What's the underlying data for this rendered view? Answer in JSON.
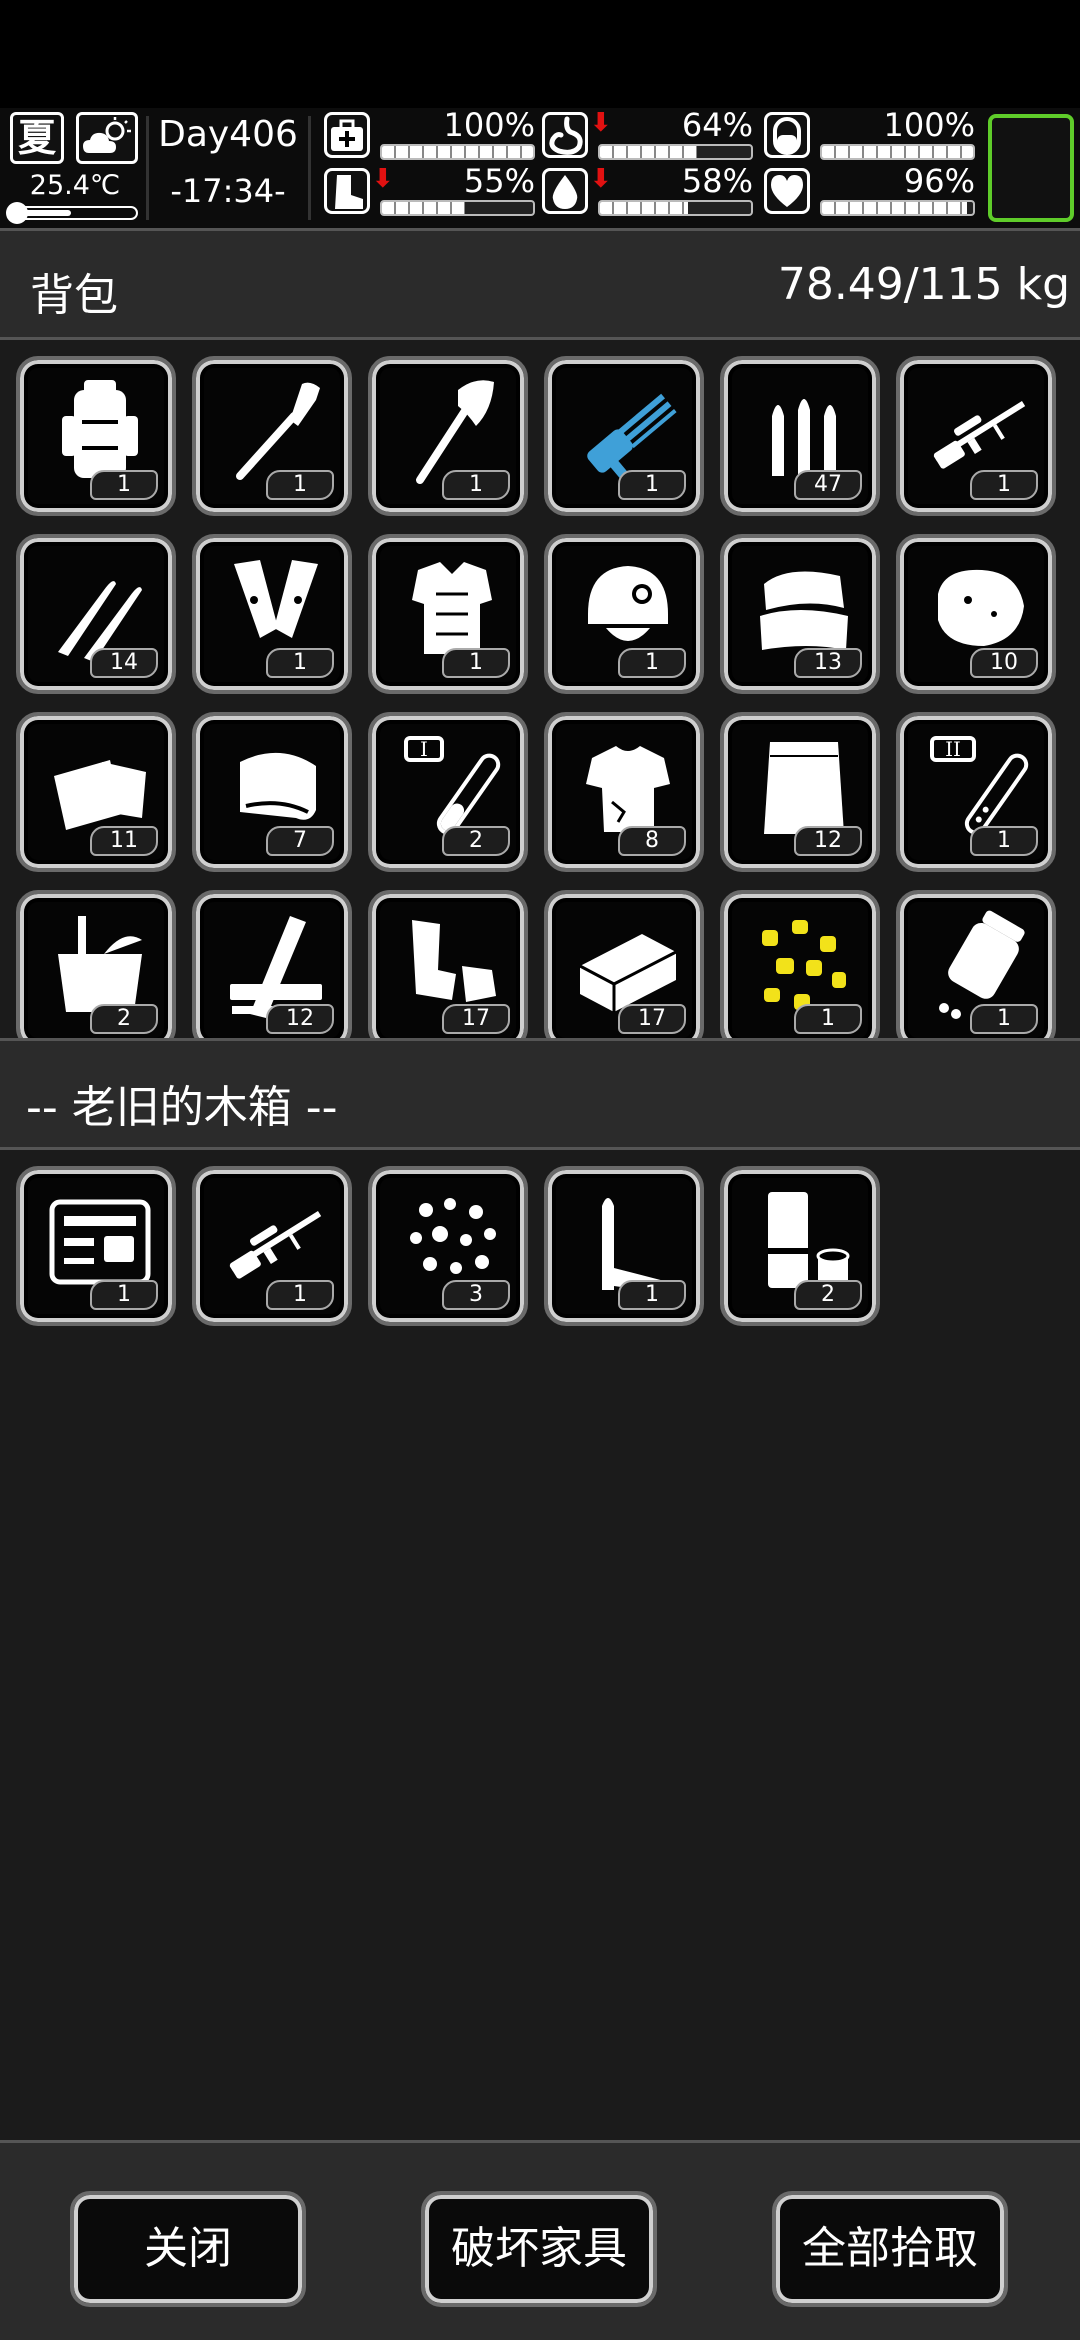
{
  "status": {
    "season": "夏",
    "weather_icon": "partly-cloudy-icon",
    "temperature": "25.4℃",
    "temperature_level": 0.45,
    "day": "Day406",
    "time": "-17:34-",
    "stats": [
      {
        "name": "health",
        "icon": "medkit-icon",
        "percent": "100%",
        "value": 100,
        "decreasing": false
      },
      {
        "name": "hunger",
        "icon": "stomach-icon",
        "percent": "64%",
        "value": 64,
        "decreasing": true
      },
      {
        "name": "sanity",
        "icon": "mind-icon",
        "percent": "100%",
        "value": 100,
        "decreasing": false
      },
      {
        "name": "stamina",
        "icon": "boot-icon",
        "percent": "55%",
        "value": 55,
        "decreasing": true
      },
      {
        "name": "thirst",
        "icon": "water-drop-icon",
        "percent": "58%",
        "value": 58,
        "decreasing": true
      },
      {
        "name": "mood",
        "icon": "heart-icon",
        "percent": "96%",
        "value": 96,
        "decreasing": false
      }
    ],
    "accent_color": "#5fcc2a",
    "decrease_color": "#e11111"
  },
  "backpack": {
    "title": "背包",
    "weight": "78.49/115 kg",
    "items": [
      {
        "icon": "backpack-icon",
        "qty": "1"
      },
      {
        "icon": "shovel-icon",
        "qty": "1"
      },
      {
        "icon": "axe-icon",
        "qty": "1"
      },
      {
        "icon": "minigun-icon",
        "qty": "1",
        "color": "#3fa0d8"
      },
      {
        "icon": "ammo-icon",
        "qty": "47"
      },
      {
        "icon": "sniper-rifle-icon",
        "qty": "1"
      },
      {
        "icon": "rifle-rounds-icon",
        "qty": "14"
      },
      {
        "icon": "leg-guards-icon",
        "qty": "1"
      },
      {
        "icon": "body-armor-icon",
        "qty": "1"
      },
      {
        "icon": "helmet-icon",
        "qty": "1"
      },
      {
        "icon": "cloth-pile-icon",
        "qty": "13"
      },
      {
        "icon": "meat-icon",
        "qty": "10"
      },
      {
        "icon": "bandage-icon",
        "qty": "11"
      },
      {
        "icon": "towel-icon",
        "qty": "7"
      },
      {
        "icon": "test-tube-1-icon",
        "qty": "2"
      },
      {
        "icon": "torn-shirt-icon",
        "qty": "8"
      },
      {
        "icon": "paper-sack-icon",
        "qty": "12"
      },
      {
        "icon": "test-tube-2-icon",
        "qty": "1"
      },
      {
        "icon": "bucket-icon",
        "qty": "2"
      },
      {
        "icon": "wood-planks-icon",
        "qty": "12"
      },
      {
        "icon": "scrap-metal-icon",
        "qty": "17"
      },
      {
        "icon": "brick-icon",
        "qty": "17"
      },
      {
        "icon": "gold-nuggets-icon",
        "qty": "1",
        "color": "#f2e21a"
      },
      {
        "icon": "pill-bottle-icon",
        "qty": "1"
      }
    ]
  },
  "container": {
    "title": "-- 老旧的木箱 --",
    "items": [
      {
        "icon": "toolbox-icon",
        "qty": "1"
      },
      {
        "icon": "sniper-rifle-icon",
        "qty": "1"
      },
      {
        "icon": "pebbles-icon",
        "qty": "3"
      },
      {
        "icon": "knife-icon",
        "qty": "1"
      },
      {
        "icon": "rolls-icon",
        "qty": "2"
      }
    ]
  },
  "buttons": {
    "close": "关闭",
    "destroy": "破坏家具",
    "take_all": "全部拾取"
  }
}
